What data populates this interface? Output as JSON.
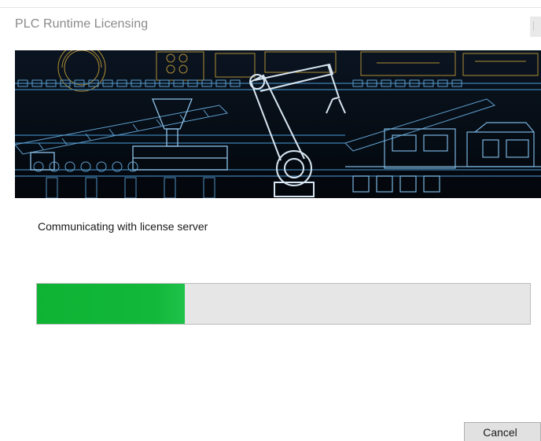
{
  "window": {
    "title": "PLC Runtime Licensing"
  },
  "banner": {
    "description_icon": "factory-automation-blueprint"
  },
  "status": {
    "message": "Communicating with license server"
  },
  "progress": {
    "value_percent": 30,
    "fill_color": "#12b83a",
    "track_color": "#e6e6e6"
  },
  "buttons": {
    "cancel_label": "Cancel"
  }
}
